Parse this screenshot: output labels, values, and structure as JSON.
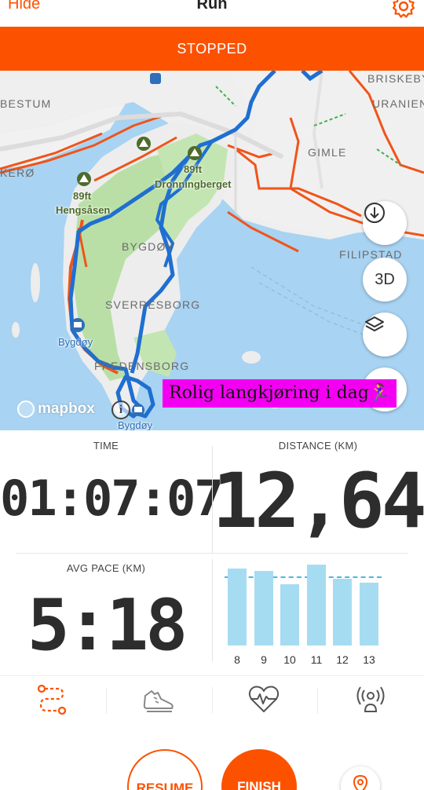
{
  "header": {
    "hide_label": "Hide",
    "title": "Run",
    "settings_icon": "gear-icon"
  },
  "status": {
    "label": "STOPPED"
  },
  "map": {
    "areas": {
      "bestum": "BESTUM",
      "briskeby": "BRISKEBY",
      "uranien": "URANIEN",
      "gimle": "GIMLE",
      "kero": "KERØ",
      "filipstad": "FILIPSTAD",
      "bygdoy": "BYGDØY",
      "svalesborg": "SVERRESBORG",
      "fredensborg": "FREDENSBORG"
    },
    "pois": {
      "hengsasen_elev": "89ft",
      "hengsasen": "Hengsåsen",
      "dronningberget_elev": "89ft",
      "dronningberget": "Dronningberget",
      "bygdoy_a": "Bygdøy",
      "bygdoy_b": "Bygdøy"
    },
    "buttons": {
      "download_icon": "download-icon",
      "three_d": "3D",
      "layers_icon": "layers-icon"
    },
    "attribution": "mapbox",
    "caption": "Rolig langkjøring i dag🏃‍♀️"
  },
  "stats": {
    "time_label": "TIME",
    "time_value": "01:07:07",
    "distance_label": "DISTANCE (KM)",
    "distance_value": "12,64",
    "pace_label": "AVG PACE (KM)",
    "pace_value": "5:18"
  },
  "splits_chart": {
    "type": "bar",
    "categories": [
      "8",
      "9",
      "10",
      "11",
      "12",
      "13"
    ],
    "values": [
      0.92,
      0.9,
      0.74,
      0.97,
      0.8,
      0.75
    ],
    "average": 0.83,
    "color": "#a6dcf2",
    "avg_line_color": "#4cb6e2"
  },
  "tabs": [
    {
      "icon": "route-icon",
      "active": true
    },
    {
      "icon": "shoe-icon",
      "active": false
    },
    {
      "icon": "heart-rate-icon",
      "active": false
    },
    {
      "icon": "beacon-icon",
      "active": false
    }
  ],
  "controls": {
    "resume_label": "RESUME",
    "finish_label": "FINISH",
    "locate_icon": "location-pin-icon"
  },
  "colors": {
    "accent": "#fc5200",
    "route": "#1f6fd1",
    "water": "#a8d3f2",
    "park": "#b9dfa6"
  }
}
